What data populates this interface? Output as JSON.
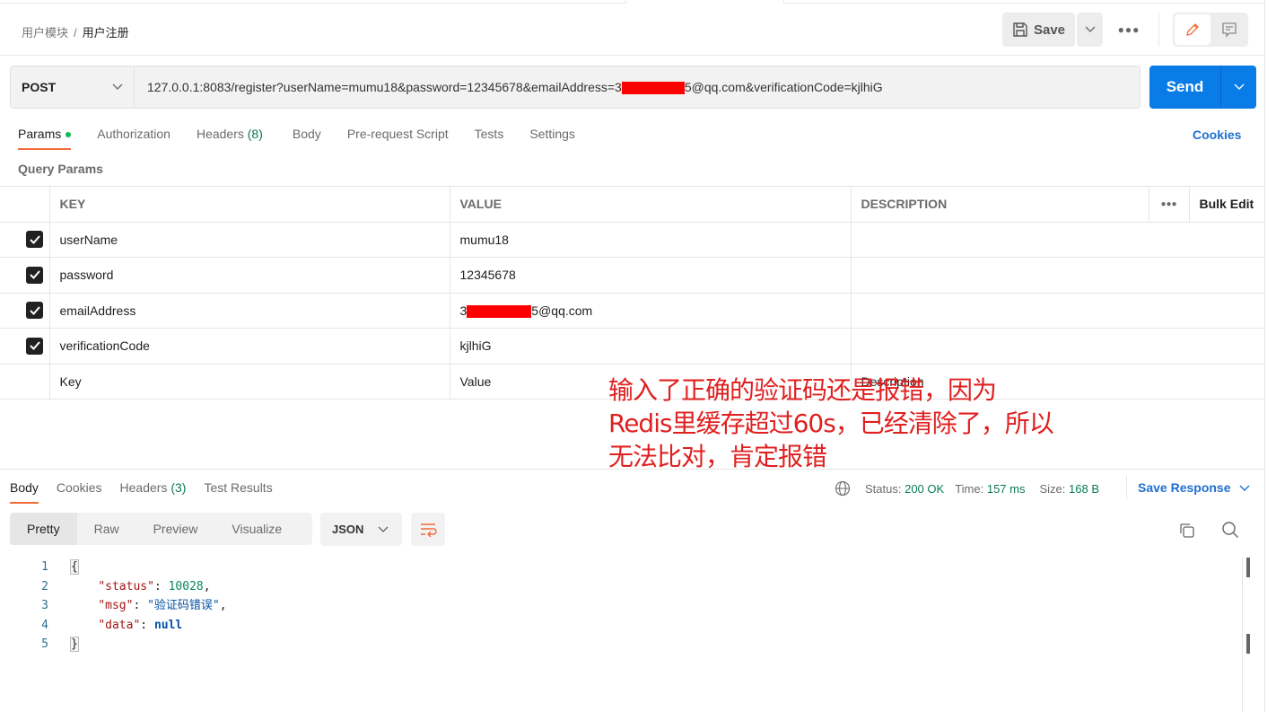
{
  "breadcrumb": {
    "parent": "用户模块",
    "current": "用户注册"
  },
  "toolbar": {
    "save_label": "Save",
    "more_icon": "more-horizontal-icon"
  },
  "request": {
    "method": "POST",
    "url_prefix": "127.0.0.1:8083/register?userName=mumu18&password=12345678&emailAddress=3",
    "url_suffix": "5@qq.com&verificationCode=kjlhiG",
    "send_label": "Send"
  },
  "request_tabs": [
    {
      "label": "Params",
      "active": true
    },
    {
      "label": "Authorization"
    },
    {
      "label": "Headers",
      "count": "(8)"
    },
    {
      "label": "Body"
    },
    {
      "label": "Pre-request Script"
    },
    {
      "label": "Tests"
    },
    {
      "label": "Settings"
    }
  ],
  "cookies_label": "Cookies",
  "query_params_label": "Query Params",
  "params_table": {
    "headers": {
      "key": "KEY",
      "value": "VALUE",
      "description": "DESCRIPTION",
      "bulk_edit": "Bulk Edit"
    },
    "rows": [
      {
        "key": "userName",
        "value": "mumu18",
        "checked": true
      },
      {
        "key": "password",
        "value": "12345678",
        "checked": true
      },
      {
        "key": "emailAddress",
        "value_prefix": "3",
        "value_suffix": "5@qq.com",
        "checked": true
      },
      {
        "key": "verificationCode",
        "value": "kjlhiG",
        "checked": true
      }
    ],
    "placeholders": {
      "key": "Key",
      "value": "Value",
      "description": "Description"
    }
  },
  "annotation": {
    "lines": [
      "输入了正确的验证码还是报错，因为",
      "Redis里缓存超过60s，已经清除了，所以",
      "无法比对，肯定报错"
    ],
    "color": "#e02020"
  },
  "response_tabs": [
    {
      "label": "Body",
      "active": true
    },
    {
      "label": "Cookies"
    },
    {
      "label": "Headers",
      "count": "(3)"
    },
    {
      "label": "Test Results"
    }
  ],
  "response_meta": {
    "status_label": "Status:",
    "status": "200 OK",
    "time_label": "Time:",
    "time": "157 ms",
    "size_label": "Size:",
    "size": "168 B",
    "save_response": "Save Response"
  },
  "view_modes": [
    "Pretty",
    "Raw",
    "Preview",
    "Visualize"
  ],
  "format": "JSON",
  "response_body": {
    "line_numbers": [
      "1",
      "2",
      "3",
      "4",
      "5"
    ],
    "open": "{",
    "close": "}",
    "status_key": "\"status\"",
    "status_value": "10028",
    "msg_key": "\"msg\"",
    "msg_value": "\"验证码错误\"",
    "data_key": "\"data\"",
    "data_value": "null"
  },
  "colors": {
    "accent": "#f26b3a",
    "send": "#0a7ce8",
    "link": "#1f6fd0",
    "ok": "#0b7a52"
  }
}
